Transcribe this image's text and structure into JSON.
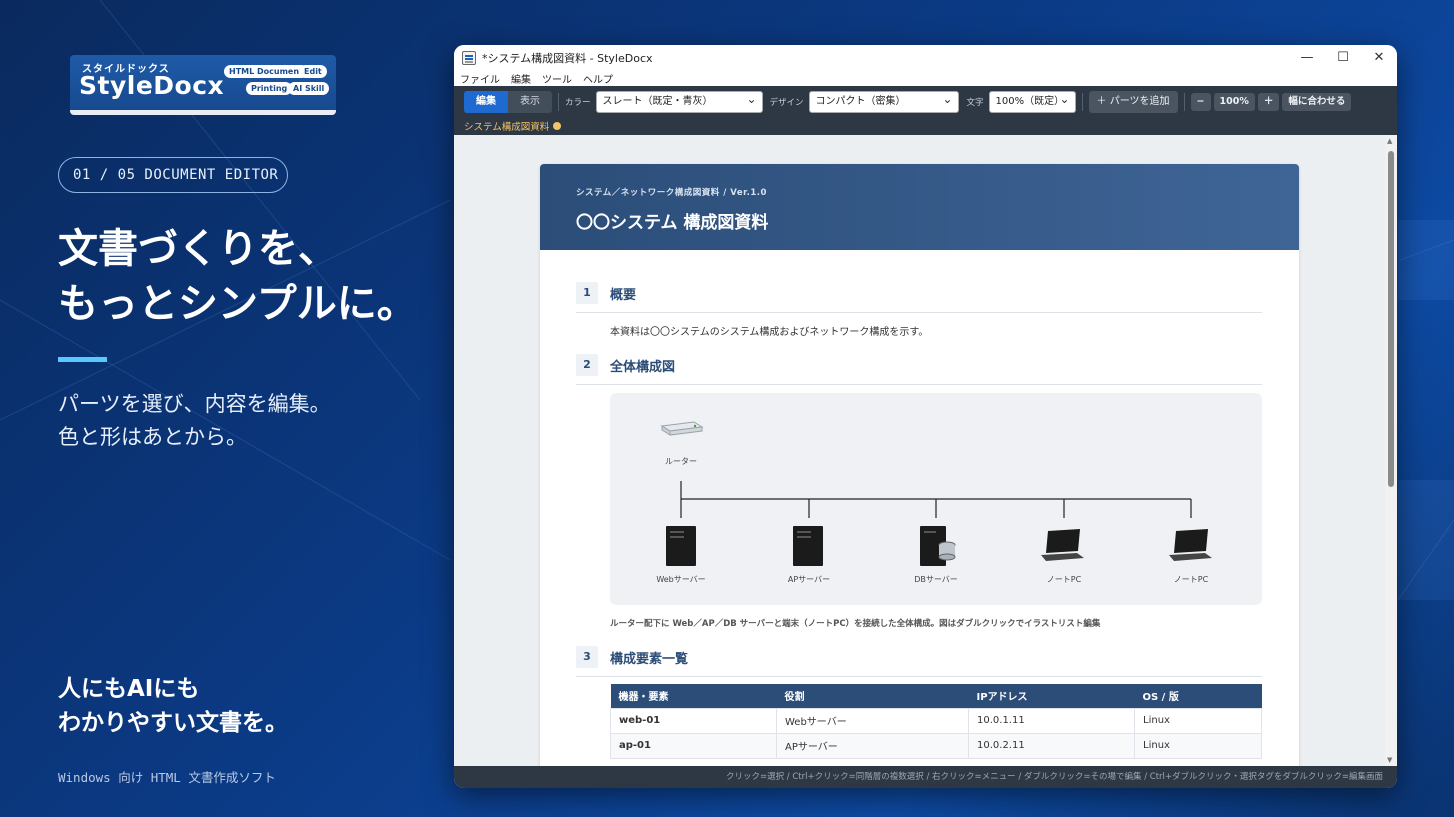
{
  "brand": {
    "kana": "スタイルドックス",
    "name": "StyleDocx",
    "badges": [
      "HTML Document",
      "Edit",
      "Printing",
      "AI Skill"
    ]
  },
  "step": "01 / 05   DOCUMENT EDITOR",
  "headline": [
    "文書づくりを、",
    "もっとシンプルに。"
  ],
  "subtext": [
    "パーツを選び、内容を編集。",
    "色と形はあとから。"
  ],
  "tagline": [
    "人にもAIにも",
    "わかりやすい文書を。"
  ],
  "footnote": "Windows 向け HTML 文書作成ソフト",
  "colors": {
    "accent": "#5ac8fa",
    "toolbar": "#2e3844",
    "primary": "#1f6ad0",
    "header": "#2b4d78"
  },
  "window": {
    "title": "*システム構成図資料 - StyleDocx",
    "controls": [
      "—",
      "☐",
      "✕"
    ],
    "menu": [
      "ファイル",
      "編集",
      "ツール",
      "ヘルプ"
    ],
    "toolbar": {
      "mode_edit": "編集",
      "mode_view": "表示",
      "color_label": "カラー",
      "color_value": "スレート（既定・青灰）",
      "design_label": "デザイン",
      "design_value": "コンパクト（密集）",
      "text_label": "文字",
      "text_value": "100%（既定）",
      "add_parts": "＋ パーツを追加",
      "zoom_out": "−",
      "zoom_value": "100%",
      "zoom_in": "＋",
      "fit_width": "幅に合わせる"
    },
    "tab": "システム構成図資料",
    "status": "クリック=選択 / Ctrl+クリック=同階層の複数選択 / 右クリック=メニュー / ダブルクリック=その場で編集 / Ctrl+ダブルクリック・選択タグをダブルクリック=編集画面"
  },
  "document": {
    "kicker": "システム／ネットワーク構成図資料 / Ver.1.0",
    "title": "〇〇システム 構成図資料",
    "sections": [
      {
        "num": "1",
        "title": "概要"
      },
      {
        "num": "2",
        "title": "全体構成図"
      },
      {
        "num": "3",
        "title": "構成要素一覧"
      }
    ],
    "overview": "本資料は〇〇システムのシステム構成およびネットワーク構成を示す。",
    "diagram": {
      "router": "ルーター",
      "nodes": [
        "Webサーバー",
        "APサーバー",
        "DBサーバー",
        "ノートPC",
        "ノートPC"
      ]
    },
    "caption": "ルーター配下に Web／AP／DB サーバーと端末（ノートPC）を接続した全体構成。図はダブルクリックでイラストリスト編集",
    "table": {
      "headers": [
        "機器・要素",
        "役割",
        "IPアドレス",
        "OS / 版"
      ],
      "rows": [
        [
          "web-01",
          "Webサーバー",
          "10.0.1.11",
          "Linux"
        ],
        [
          "ap-01",
          "APサーバー",
          "10.0.2.11",
          "Linux"
        ]
      ]
    }
  }
}
